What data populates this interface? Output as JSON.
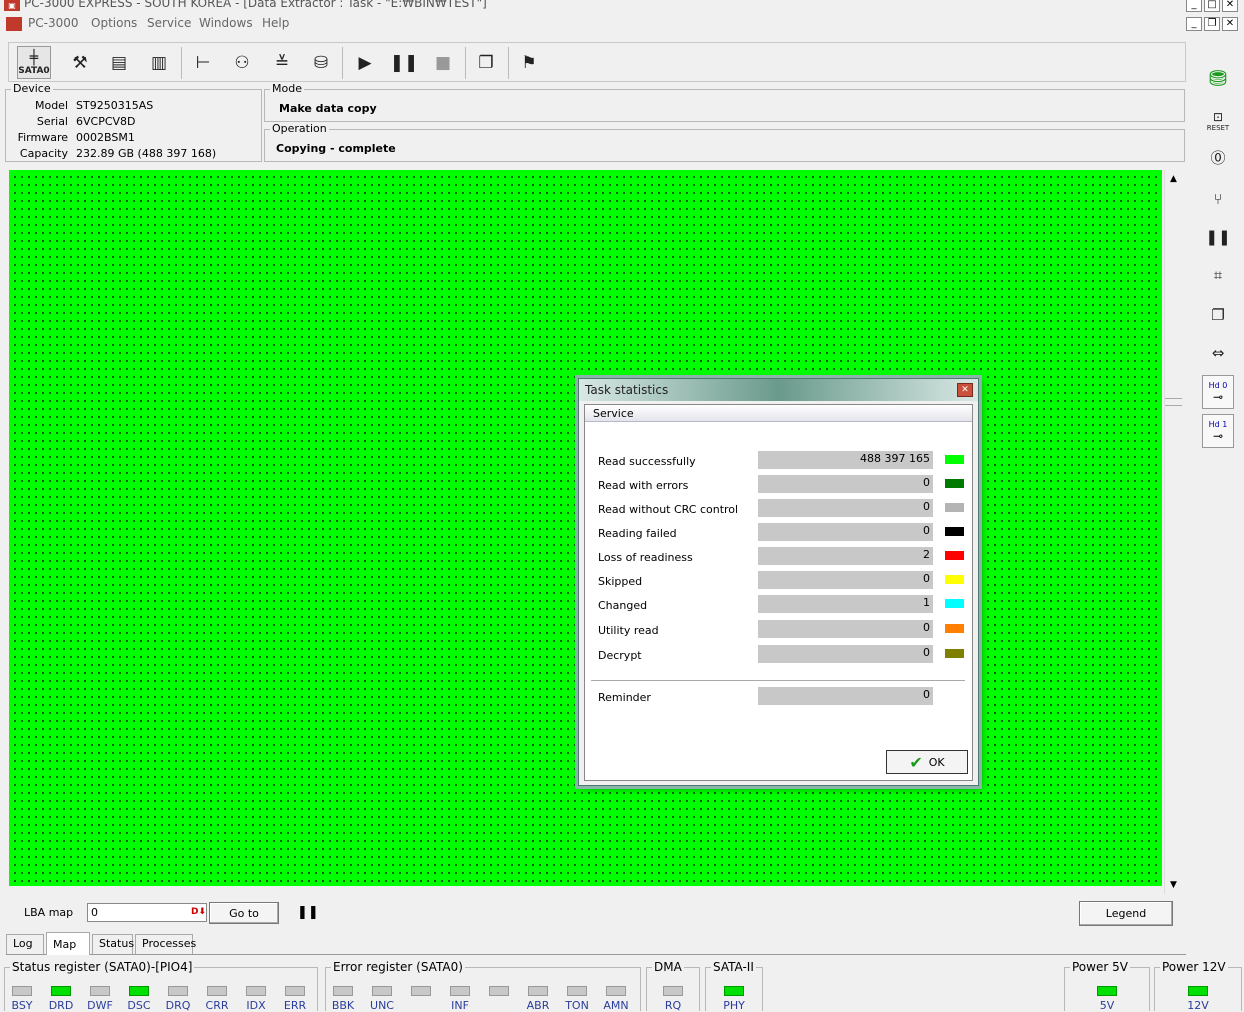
{
  "window": {
    "title": "PC-3000 EXPRESS - SOUTH KOREA - [Data Extractor : Task - \"E:₩BIN₩TEST\"]"
  },
  "menu": [
    "PC-3000",
    "Options",
    "Service",
    "Windows",
    "Help"
  ],
  "toolbar": {
    "sata_label": "SATA0",
    "icons": [
      "tools-icon",
      "id-icon",
      "percent-icon",
      "tree-icon",
      "binoculars-icon",
      "split-icon",
      "disk-icon",
      "play-icon",
      "pause-icon",
      "stop-icon",
      "copy-icon",
      "run-icon"
    ]
  },
  "device": {
    "title": "Device",
    "model_label": "Model",
    "model": "ST9250315AS",
    "serial_label": "Serial",
    "serial": "6VCPCV8D",
    "firmware_label": "Firmware",
    "firmware": "0002BSM1",
    "capacity_label": "Capacity",
    "capacity": "232.89 GB (488 397 168)"
  },
  "mode": {
    "title": "Mode",
    "value": "Make data copy"
  },
  "operation": {
    "title": "Operation",
    "value": "Copying - complete"
  },
  "right_toolbar": {
    "reset_label": "RESET",
    "hd0_label": "Hd 0",
    "hd1_label": "Hd 1"
  },
  "lba": {
    "label": "LBA map",
    "value": "0",
    "goto_label": "Go to",
    "legend_label": "Legend"
  },
  "tabs": [
    "Log",
    "Map",
    "Status",
    "Processes"
  ],
  "active_tab": "Map",
  "status_register": {
    "title": "Status register (SATA0)-[PIO4]",
    "leds": [
      {
        "label": "BSY",
        "on": false
      },
      {
        "label": "DRD",
        "on": true
      },
      {
        "label": "DWF",
        "on": false
      },
      {
        "label": "DSC",
        "on": true
      },
      {
        "label": "DRQ",
        "on": false
      },
      {
        "label": "CRR",
        "on": false
      },
      {
        "label": "IDX",
        "on": false
      },
      {
        "label": "ERR",
        "on": false
      }
    ]
  },
  "error_register": {
    "title": "Error register (SATA0)",
    "leds": [
      {
        "label": "BBK",
        "on": false
      },
      {
        "label": "UNC",
        "on": false
      },
      {
        "label": "",
        "on": false
      },
      {
        "label": "INF",
        "on": false
      },
      {
        "label": "",
        "on": false
      },
      {
        "label": "ABR",
        "on": false
      },
      {
        "label": "TON",
        "on": false
      },
      {
        "label": "AMN",
        "on": false
      }
    ]
  },
  "dma": {
    "title": "DMA",
    "leds": [
      {
        "label": "RQ",
        "on": false
      }
    ]
  },
  "sata2": {
    "title": "SATA-II",
    "leds": [
      {
        "label": "PHY",
        "on": true
      }
    ]
  },
  "power5": {
    "title": "Power 5V",
    "leds": [
      {
        "label": "5V",
        "on": true
      }
    ]
  },
  "power12": {
    "title": "Power 12V",
    "leds": [
      {
        "label": "12V",
        "on": true
      }
    ]
  },
  "dialog": {
    "title": "Task statistics",
    "section": "Service",
    "rows": [
      {
        "label": "Read successfully",
        "value": "488 397 165",
        "color": "#00ff00"
      },
      {
        "label": "Read with errors",
        "value": "0",
        "color": "#007a00"
      },
      {
        "label": "Read without CRC control",
        "value": "0",
        "color": "#b4b4b4"
      },
      {
        "label": "Reading failed",
        "value": "0",
        "color": "#000000"
      },
      {
        "label": "Loss of readiness",
        "value": "2",
        "color": "#ff0000"
      },
      {
        "label": "Skipped",
        "value": "0",
        "color": "#ffff00"
      },
      {
        "label": "Changed",
        "value": "1",
        "color": "#00ffff"
      },
      {
        "label": "Utility read",
        "value": "0",
        "color": "#ff8000"
      },
      {
        "label": "Decrypt",
        "value": "0",
        "color": "#808000"
      }
    ],
    "reminder": {
      "label": "Reminder",
      "value": "0",
      "color": "#ffffff"
    },
    "ok_label": "OK"
  }
}
